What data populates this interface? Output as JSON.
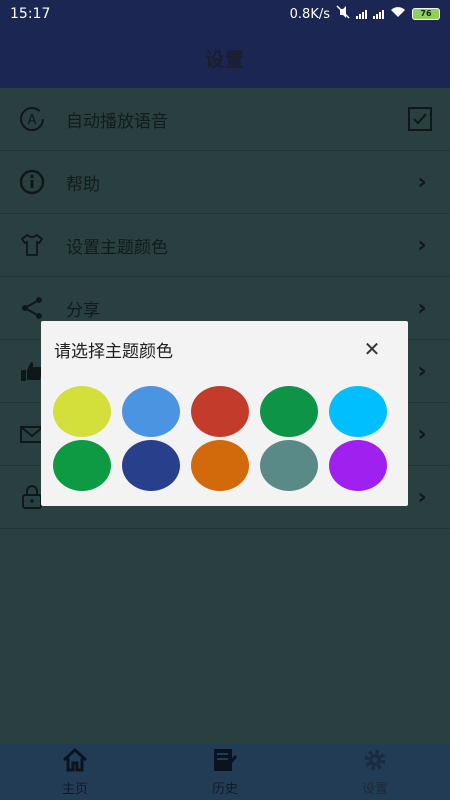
{
  "status": {
    "time": "15:17",
    "speed": "0.8K/s",
    "battery": "76"
  },
  "header": {
    "title": "设置"
  },
  "list": [
    {
      "name": "auto-play-voice",
      "label": "自动播放语音",
      "icon": "auto-voice-icon",
      "control": "checkbox",
      "checked": true
    },
    {
      "name": "help",
      "label": "帮助",
      "icon": "info-icon",
      "control": "chevron"
    },
    {
      "name": "theme-color",
      "label": "设置主题颜色",
      "icon": "shirt-icon",
      "control": "chevron"
    },
    {
      "name": "share",
      "label": "分享",
      "icon": "share-icon",
      "control": "chevron"
    },
    {
      "name": "rate",
      "label": "",
      "icon": "thumbs-up-icon",
      "control": "chevron"
    },
    {
      "name": "feedback",
      "label": "",
      "icon": "mail-icon",
      "control": "chevron"
    },
    {
      "name": "privacy",
      "label": "",
      "icon": "lock-icon",
      "control": "chevron"
    }
  ],
  "dialog": {
    "title": "请选择主题颜色",
    "close_icon": "close-icon",
    "colors": [
      "#d3df3a",
      "#4a94e2",
      "#c23b2b",
      "#0d9447",
      "#00bfff",
      "#0d9a42",
      "#283f8c",
      "#d2690a",
      "#5a8a88",
      "#a020f0"
    ]
  },
  "tabs": [
    {
      "label": "主页",
      "icon": "home-icon",
      "active": false
    },
    {
      "label": "历史",
      "icon": "history-icon",
      "active": false
    },
    {
      "label": "设置",
      "icon": "gear-icon",
      "active": true
    }
  ]
}
